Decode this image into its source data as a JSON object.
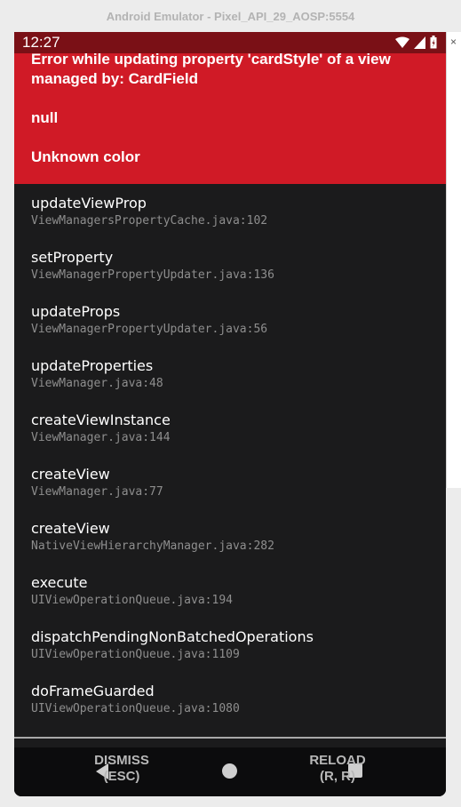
{
  "window": {
    "title": "Android Emulator - Pixel_API_29_AOSP:5554"
  },
  "side_panel": {
    "close_glyph": "×"
  },
  "status_bar": {
    "time": "12:27",
    "icons": [
      "wifi-icon",
      "signal-icon",
      "battery-icon"
    ]
  },
  "error": {
    "line1": "Error while updating property 'cardStyle' of a view",
    "line2": "managed by: CardField",
    "line3": "null",
    "line4": "Unknown color"
  },
  "stack": [
    {
      "method": "updateViewProp",
      "file": "ViewManagersPropertyCache.java:102"
    },
    {
      "method": "setProperty",
      "file": "ViewManagerPropertyUpdater.java:136"
    },
    {
      "method": "updateProps",
      "file": "ViewManagerPropertyUpdater.java:56"
    },
    {
      "method": "updateProperties",
      "file": "ViewManager.java:48"
    },
    {
      "method": "createViewInstance",
      "file": "ViewManager.java:144"
    },
    {
      "method": "createView",
      "file": "ViewManager.java:77"
    },
    {
      "method": "createView",
      "file": "NativeViewHierarchyManager.java:282"
    },
    {
      "method": "execute",
      "file": "UIViewOperationQueue.java:194"
    },
    {
      "method": "dispatchPendingNonBatchedOperations",
      "file": "UIViewOperationQueue.java:1109"
    },
    {
      "method": "doFrameGuarded",
      "file": "UIViewOperationQueue.java:1080"
    }
  ],
  "footer": {
    "dismiss_line1": "DISMISS",
    "dismiss_line2": "(ESC)",
    "reload_line1": "RELOAD",
    "reload_line2": "(R, R)"
  },
  "colors": {
    "error_red": "#d01a26",
    "status_bar": "#7a1016",
    "background": "#1b1b1c"
  }
}
